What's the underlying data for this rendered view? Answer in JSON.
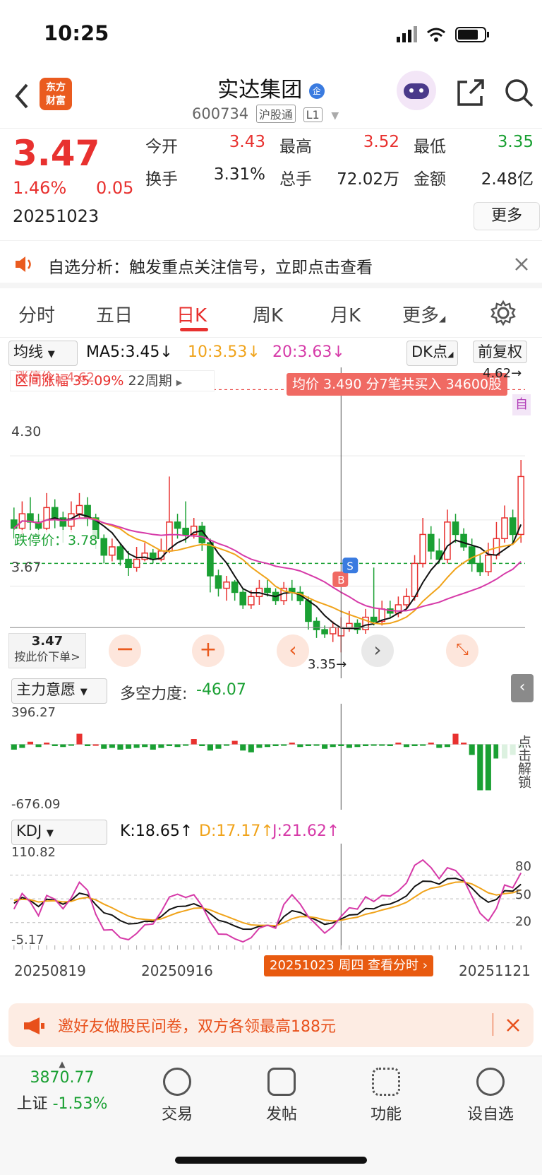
{
  "status_bar": {
    "time": "10:25"
  },
  "header": {
    "logo_text_1": "东方",
    "logo_text_2": "财富",
    "stock_name": "实达集团",
    "stock_code": "600734",
    "exchange_tag": "沪股通",
    "level_tag": "L1",
    "company_badge": "企"
  },
  "quote": {
    "price": "3.47",
    "change_pct": "1.46%",
    "change_amt": "0.05",
    "date": "20251023",
    "open_label": "今开",
    "open": "3.43",
    "high_label": "最高",
    "high": "3.52",
    "low_label": "最低",
    "low": "3.35",
    "turnover_label": "换手",
    "turnover": "3.31%",
    "volume_label": "总手",
    "volume": "72.02万",
    "amount_label": "金额",
    "amount": "2.48亿",
    "more_button": "更多"
  },
  "notice": {
    "text": "自选分析：触发重点关注信号，立即点击查看"
  },
  "tabs": [
    {
      "label": "分时"
    },
    {
      "label": "五日"
    },
    {
      "label": "日K"
    },
    {
      "label": "周K"
    },
    {
      "label": "月K"
    },
    {
      "label": "更多"
    }
  ],
  "chart": {
    "ma_selector": "均线",
    "ma5": "MA5:3.45↓",
    "ma10": "10:3.53↓",
    "ma20": "20:3.63↓",
    "dk_button": "DK点",
    "fq_button": "前复权",
    "limit_up_label": "涨停价：4.62",
    "interval_gain": "区间涨幅 35.09%",
    "period": "22周期",
    "trade_tip": "均价 3.490 分7笔共买入 34600股",
    "high_marker": "4.62→",
    "self_tag": "自",
    "y_label_high": "4.30",
    "y_label_low": "3.67",
    "limit_down_label": "跌停价：3.78",
    "low_marker": "3.35→",
    "cursor_price": "3.47",
    "cursor_hint": "按此价下单>",
    "buy_tag": "B",
    "sell_tag": "S",
    "colors": {
      "up": "#e8312f",
      "down": "#1aa033",
      "ma10": "#f0a31a",
      "ma20": "#d63aa8",
      "ma5": "#111111"
    },
    "candles": [
      [
        3.99,
        3.95,
        4.05,
        3.9
      ],
      [
        3.95,
        4.02,
        4.08,
        3.92
      ],
      [
        4.02,
        3.98,
        4.1,
        3.94
      ],
      [
        3.98,
        3.95,
        4.02,
        3.9
      ],
      [
        3.95,
        4.05,
        4.12,
        3.93
      ],
      [
        4.05,
        4.0,
        4.09,
        3.95
      ],
      [
        4.0,
        3.96,
        4.03,
        3.88
      ],
      [
        3.96,
        4.02,
        4.08,
        3.93
      ],
      [
        4.02,
        4.06,
        4.12,
        4.0
      ],
      [
        4.06,
        4.0,
        4.1,
        3.96
      ],
      [
        4.0,
        3.9,
        4.02,
        3.85
      ],
      [
        3.9,
        3.82,
        3.92,
        3.78
      ],
      [
        3.82,
        3.86,
        3.9,
        3.79
      ],
      [
        3.86,
        3.8,
        3.88,
        3.77
      ],
      [
        3.8,
        3.76,
        3.84,
        3.72
      ],
      [
        3.76,
        3.8,
        3.86,
        3.74
      ],
      [
        3.8,
        3.83,
        3.88,
        3.79
      ],
      [
        3.83,
        3.8,
        3.85,
        3.78
      ],
      [
        3.8,
        3.84,
        3.9,
        3.79
      ],
      [
        3.84,
        3.98,
        4.2,
        3.83
      ],
      [
        3.98,
        3.95,
        4.02,
        3.9
      ],
      [
        3.95,
        3.92,
        4.08,
        3.88
      ],
      [
        3.92,
        3.96,
        4.0,
        3.9
      ],
      [
        3.96,
        3.88,
        3.98,
        3.84
      ],
      [
        3.88,
        3.72,
        3.9,
        3.64
      ],
      [
        3.72,
        3.66,
        3.75,
        3.62
      ],
      [
        3.66,
        3.69,
        3.72,
        3.6
      ],
      [
        3.69,
        3.64,
        3.7,
        3.6
      ],
      [
        3.64,
        3.58,
        3.66,
        3.56
      ],
      [
        3.58,
        3.62,
        3.65,
        3.56
      ],
      [
        3.62,
        3.66,
        3.7,
        3.58
      ],
      [
        3.66,
        3.64,
        3.7,
        3.62
      ],
      [
        3.64,
        3.6,
        3.66,
        3.58
      ],
      [
        3.6,
        3.66,
        3.69,
        3.58
      ],
      [
        3.66,
        3.64,
        3.7,
        3.6
      ],
      [
        3.64,
        3.6,
        3.67,
        3.58
      ],
      [
        3.6,
        3.5,
        3.62,
        3.46
      ],
      [
        3.5,
        3.46,
        3.52,
        3.42
      ],
      [
        3.46,
        3.44,
        3.48,
        3.42
      ],
      [
        3.44,
        3.47,
        3.5,
        3.4
      ],
      [
        3.43,
        3.47,
        3.52,
        3.35
      ],
      [
        3.47,
        3.49,
        3.55,
        3.45
      ],
      [
        3.49,
        3.46,
        3.51,
        3.44
      ],
      [
        3.46,
        3.52,
        3.56,
        3.44
      ],
      [
        3.52,
        3.5,
        3.76,
        3.48
      ],
      [
        3.5,
        3.56,
        3.6,
        3.48
      ],
      [
        3.56,
        3.54,
        3.6,
        3.52
      ],
      [
        3.54,
        3.58,
        3.62,
        3.52
      ],
      [
        3.58,
        3.62,
        3.66,
        3.56
      ],
      [
        3.62,
        3.78,
        3.82,
        3.6
      ],
      [
        3.78,
        3.92,
        4.0,
        3.76
      ],
      [
        3.92,
        3.84,
        3.96,
        3.8
      ],
      [
        3.84,
        3.8,
        3.9,
        3.78
      ],
      [
        3.8,
        3.98,
        4.04,
        3.78
      ],
      [
        3.98,
        3.92,
        4.02,
        3.88
      ],
      [
        3.92,
        3.86,
        3.95,
        3.84
      ],
      [
        3.86,
        3.78,
        3.9,
        3.74
      ],
      [
        3.78,
        3.74,
        3.82,
        3.72
      ],
      [
        3.74,
        3.82,
        3.88,
        3.72
      ],
      [
        3.82,
        3.9,
        3.98,
        3.8
      ],
      [
        3.9,
        4.0,
        4.06,
        3.88
      ],
      [
        4.0,
        3.92,
        4.04,
        3.88
      ],
      [
        3.92,
        4.2,
        4.28,
        3.88
      ]
    ],
    "main_indicator": "主力意愿",
    "main_indicator_value_label": "多空力度:",
    "main_indicator_value": "-46.07",
    "main_max": "396.27",
    "main_min": "-676.09",
    "unlock_label": "点击解锁",
    "main_bars": [
      -60,
      -40,
      30,
      -30,
      20,
      -20,
      -30,
      -10,
      120,
      -20,
      0,
      -50,
      -40,
      -60,
      -50,
      -40,
      -30,
      -60,
      -40,
      -20,
      -30,
      -10,
      60,
      -20,
      -70,
      -50,
      -10,
      40,
      -70,
      -90,
      -40,
      -30,
      -20,
      -10,
      20,
      -30,
      -20,
      -10,
      -50,
      -30,
      -20,
      -40,
      -30,
      -20,
      -10,
      -10,
      -20,
      20,
      -30,
      -20,
      -10,
      20,
      -40,
      -30,
      120,
      20,
      -120,
      -520,
      -520,
      -160,
      -160,
      -120,
      -40,
      -50,
      20,
      -80
    ],
    "kdj_selector": "KDJ",
    "k_value": "K:18.65↑",
    "d_value": "D:17.17↑",
    "j_value": "J:21.62↑",
    "kdj_max": "110.82",
    "kdj_min": "-5.17",
    "kdj_levels": [
      "80",
      "50",
      "20"
    ],
    "x_labels": [
      "20250819",
      "20250916",
      "20251121"
    ],
    "cursor_date_tip": "20251023 周四 查看分时"
  },
  "ad": {
    "text": "邀好友做股民问卷，双方各领最高188元"
  },
  "bottom_nav": {
    "index_value": "3870.77",
    "index_name": "上证",
    "index_change": "-1.53%",
    "items": [
      "交易",
      "发帖",
      "功能",
      "设自选"
    ]
  }
}
